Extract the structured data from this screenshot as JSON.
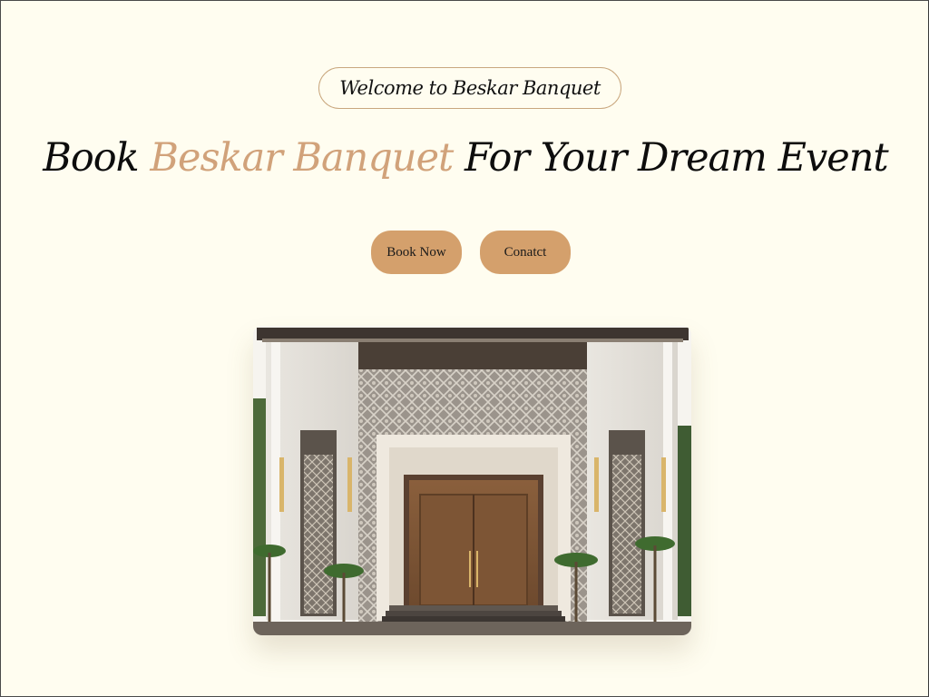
{
  "hero": {
    "welcome_text": "Welcome to Beskar Banquet",
    "title_prefix": "Book ",
    "title_accent": "Beskar Banquet",
    "title_suffix": " For Your Dream Event"
  },
  "actions": {
    "book_label": "Book Now",
    "contact_label": "Conatct"
  },
  "theme": {
    "background": "#fffdf0",
    "accent": "#d4a06c",
    "accent_text": "#d1a27a",
    "pill_border": "#c9a77e"
  },
  "image": {
    "subject": "banquet-hall-facade"
  }
}
